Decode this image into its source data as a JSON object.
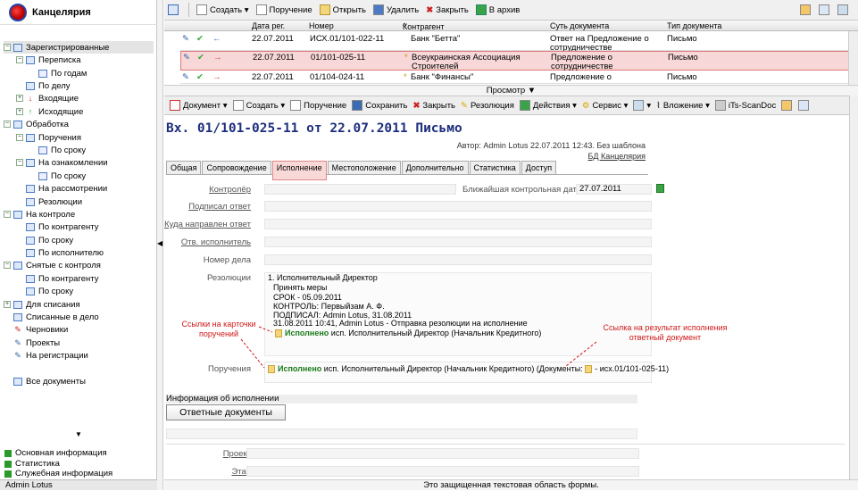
{
  "app": {
    "title": "Канцелярия",
    "user": "Admin Lotus"
  },
  "sidebar": {
    "items": [
      {
        "label": "Зарегистрированные",
        "level": 0,
        "selected": true
      },
      {
        "label": "Переписка",
        "level": 1
      },
      {
        "label": "По годам",
        "level": 2
      },
      {
        "label": "По делу",
        "level": 1
      },
      {
        "label": "Входящие",
        "level": 1
      },
      {
        "label": "Исходящие",
        "level": 1
      },
      {
        "label": "Обработка",
        "level": 0
      },
      {
        "label": "Поручения",
        "level": 1
      },
      {
        "label": "По сроку",
        "level": 2
      },
      {
        "label": "На ознакомлении",
        "level": 1
      },
      {
        "label": "По сроку",
        "level": 2
      },
      {
        "label": "На рассмотрении",
        "level": 1
      },
      {
        "label": "Резолюции",
        "level": 1
      },
      {
        "label": "На контроле",
        "level": 0
      },
      {
        "label": "По контрагенту",
        "level": 1
      },
      {
        "label": "По сроку",
        "level": 1
      },
      {
        "label": "По исполнителю",
        "level": 1
      },
      {
        "label": "Снятые с контроля",
        "level": 0
      },
      {
        "label": "По контрагенту",
        "level": 1
      },
      {
        "label": "По сроку",
        "level": 1
      },
      {
        "label": "Для списания",
        "level": 0
      },
      {
        "label": "Списанные в дело",
        "level": 0
      },
      {
        "label": "Черновики",
        "level": 0
      },
      {
        "label": "Проекты",
        "level": 0
      },
      {
        "label": "На регистрации",
        "level": 0
      },
      {
        "label": "Все документы",
        "level": 0
      }
    ],
    "bottom": [
      "Основная информация",
      "Статистика",
      "Служебная информация"
    ]
  },
  "toolbar": {
    "create": "Создать",
    "assign": "Поручение",
    "open": "Открыть",
    "delete": "Удалить",
    "close": "Закрыть",
    "archive": "В архив"
  },
  "grid": {
    "headers": [
      "Дата рег.",
      "Номер",
      "Контрагент",
      "Суть документа",
      "Тип документа"
    ],
    "rows": [
      {
        "date": "22.07.2011",
        "num": "ИСХ.01/101-022-11",
        "party": "Банк \"Бетта\"",
        "essence": "Ответ на Предложение о сотрудничестве",
        "type": "Письмо"
      },
      {
        "date": "22.07.2011",
        "num": "01/101-025-11",
        "party": "Всеукраинская Ассоциация Строителей",
        "essence": "Предложение о сотрудничестве",
        "type": "Письмо"
      },
      {
        "date": "22.07.2011",
        "num": "01/104-024-11",
        "party": "Банк \"Финансы\"",
        "essence": "Предложение о",
        "type": "Письмо"
      }
    ],
    "preview": "Просмотр"
  },
  "doctoolbar": {
    "document": "Документ",
    "create": "Создать",
    "assign": "Поручение",
    "save": "Сохранить",
    "close": "Закрыть",
    "resolution": "Резолюция",
    "actions": "Действия",
    "service": "Сервис",
    "attachment": "Вложение",
    "scan": "iTs-ScanDoc"
  },
  "doc": {
    "title": "Вх. 01/101-025-11 от 22.07.2011 Письмо",
    "author": "Автор: Admin Lotus 22.07.2011 12:43. Без шаблона",
    "db": "БД Канцелярия",
    "tabs": [
      "Общая",
      "Сопровождение",
      "Исполнение",
      "Местоположение",
      "Дополнительно",
      "Статистика",
      "Доступ"
    ],
    "fields": {
      "controller": "Контролёр",
      "signed": "Подписал ответ",
      "sent": "Куда направлен ответ",
      "resp": "Отв. исполнитель",
      "case": "Номер дела",
      "resolutions": "Резолюции",
      "assignments": "Поручения",
      "nearest": "Ближайшая контрольная дата",
      "nearest_val": "27.07.2011"
    },
    "resolution_lines": [
      "1.       Исполнительный Директор",
      "Принять меры",
      "СРОК - 05.09.2011",
      "КОНТРОЛЬ: Первыйзам А. Ф.",
      "ПОДПИСАЛ: Admin Lotus, 31.08.2011",
      "31.08.2011 10:41, Admin Lotus - Отправка резолюции на исполнение"
    ],
    "done": "Исполнено",
    "res_done_rest": "исп. Исполнительный Директор (Начальник Кредитного)",
    "assign_done_rest": "исп. Исполнительный Директор (Начальник Кредитного)  (Документы:",
    "assign_doc": "- исх.01/101-025-11)",
    "annot_left": "Ссылки на карточки поручений",
    "annot_right": "Ссылка на результат исполнения ответный документ",
    "exec_info": "Информация об исполнении",
    "reply_docs": "Ответные документы",
    "project": "Проект",
    "stage": "Этап"
  },
  "status": "Это защищенная текстовая область формы."
}
